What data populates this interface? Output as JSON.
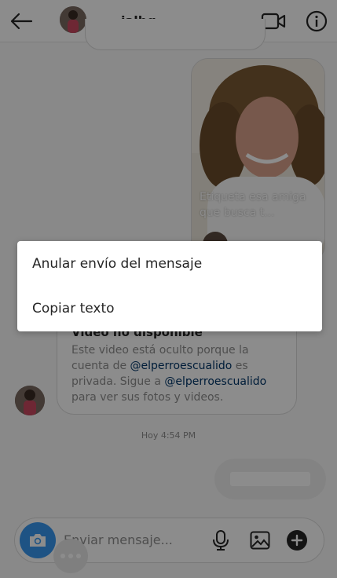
{
  "header": {
    "back_icon": "back-arrow-icon",
    "username": "ialbg",
    "video_call_icon": "video-camera-icon",
    "info_icon": "info-icon"
  },
  "thread": {
    "shared_post": {
      "caption": "Etiqueta esa amiga que busca t..."
    },
    "unavailable_video": {
      "title": "Video no disponible",
      "body_prefix": "Este video está oculto porque la cuenta de ",
      "mention_1": "@elperroescualido",
      "body_middle": " es privada. Sigue a ",
      "mention_2": "@elperroescualido",
      "body_suffix": " para ver sus fotos y videos."
    },
    "timestamp": "Hoy 4:54 PM"
  },
  "composer": {
    "placeholder": "Enviar mensaje...",
    "camera_icon": "camera-icon",
    "mic_icon": "microphone-icon",
    "gallery_icon": "image-icon",
    "plus_icon": "plus-circle-icon"
  },
  "context_menu": {
    "items": [
      {
        "label": "Anular envío del mensaje"
      },
      {
        "label": "Copiar texto"
      }
    ]
  },
  "colors": {
    "accent": "#3897f0",
    "mention": "#003569",
    "secondary_text": "#8e8e8e",
    "overlay": "rgba(0,0,0,0.45)"
  }
}
